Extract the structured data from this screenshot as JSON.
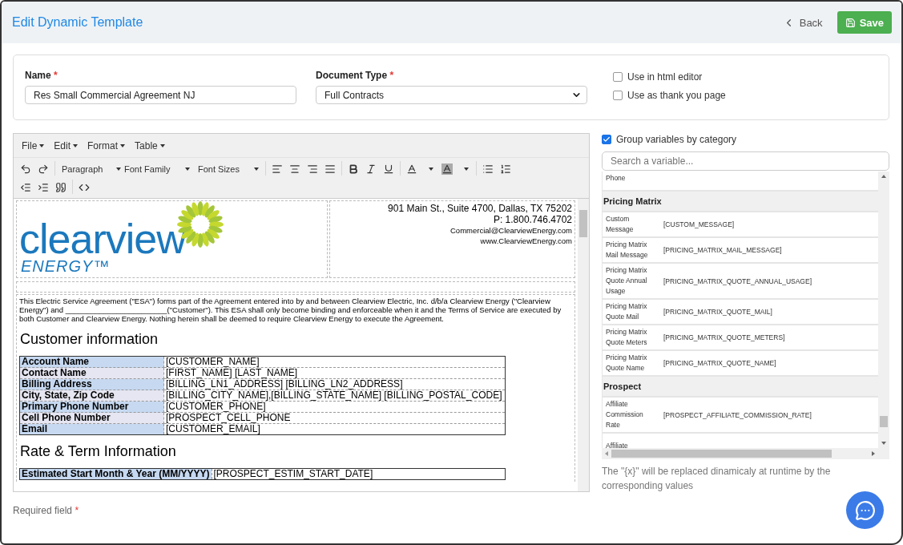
{
  "header": {
    "title": "Edit Dynamic Template",
    "back_label": "Back",
    "save_label": "Save"
  },
  "form": {
    "required_mark": "*",
    "name": {
      "label": "Name",
      "required": true,
      "value": "Res Small Commercial Agreement NJ"
    },
    "document_type": {
      "label": "Document Type",
      "required": true,
      "value": "Full Contracts"
    },
    "options": [
      {
        "label": "Use in html editor",
        "checked": false
      },
      {
        "label": "Use as thank you page",
        "checked": false
      }
    ]
  },
  "editor": {
    "menus": [
      "File",
      "Edit",
      "Format",
      "Table"
    ],
    "dropdowns": [
      "Paragraph",
      "Font Family",
      "Font Sizes"
    ],
    "document": {
      "logo": {
        "word": "clearview",
        "tagline": "ENERGY™"
      },
      "address": [
        {
          "text": "901 Main St., Suite 4700, Dallas, TX 75202",
          "kind": "large"
        },
        {
          "text": "P: 1.800.746.4702",
          "kind": "large"
        },
        {
          "text": "Commercial@ClearviewEnergy.com",
          "kind": "small"
        },
        {
          "text": "www.ClearviewEnergy.com",
          "kind": "small"
        }
      ],
      "intro": "This Electric Service Agreement (\"ESA\") forms part of the Agreement entered into by and between Clearview Electric, Inc. d/b/a Clearview Energy (\"Clearview Energy\") and ________________________(\"Customer\"). This ESA shall only become binding and enforceable when it and the Terms of Service are executed by both Customer and Clearview Energy. Nothing herein shall be deemed to require Clearview Energy to execute the Agreement.",
      "sections": [
        {
          "heading": "Customer information",
          "rows": [
            {
              "label": "Account Name",
              "value": "[CUSTOMER_NAME]"
            },
            {
              "label": "Contact Name",
              "value": "[FIRST_NAME] [LAST_NAME]"
            },
            {
              "label": "Billing Address",
              "value": "[BILLING_LN1_ADDRESS] [BILLING_LN2_ADDRESS]"
            },
            {
              "label": "City, State, Zip Code",
              "value": "[BILLING_CITY_NAME],[BILLING_STATE_NAME] [BILLING_POSTAL_CODE]"
            },
            {
              "label": "Primary Phone Number",
              "value": "[CUSTOMER_PHONE]"
            },
            {
              "label": "Cell Phone Number",
              "value": "[PROSPECT_CELL_PHONE"
            },
            {
              "label": "Email",
              "value": "[CUSTOMER_EMAIL]"
            }
          ]
        },
        {
          "heading": "Rate & Term Information",
          "rows": [
            {
              "label": "Estimated Start Month & Year (MM/YYYY)",
              "value": "[PROSPECT_ESTIM_START_DATE]"
            }
          ]
        }
      ]
    }
  },
  "variables": {
    "group_by_category": {
      "label": "Group variables by category",
      "checked": true
    },
    "search": {
      "placeholder": "Search a variable..."
    },
    "rows": [
      {
        "kind": "item",
        "label": "Phone"
      },
      {
        "kind": "category",
        "label": "Pricing Matrix"
      },
      {
        "kind": "item",
        "label": "Custom Message",
        "value": "[CUSTOM_MESSAGE]"
      },
      {
        "kind": "item",
        "label": "Pricing Matrix Mail Message",
        "value": "[PRICING_MATRIX_MAIL_MESSAGE]"
      },
      {
        "kind": "item",
        "label": "Pricing Matrix Quote Annual Usage",
        "value": "[PRICING_MATRIX_QUOTE_ANNUAL_USAGE]"
      },
      {
        "kind": "item",
        "label": "Pricing Matrix Quote Mail",
        "value": "[PRICING_MATRIX_QUOTE_MAIL]"
      },
      {
        "kind": "item",
        "label": "Pricing Matrix Quote Meters",
        "value": "[PRICING_MATRIX_QUOTE_METERS]"
      },
      {
        "kind": "item",
        "label": "Pricing Matrix Quote Name",
        "value": "[PRICING_MATRIX_QUOTE_NAME]"
      },
      {
        "kind": "category",
        "label": "Prospect"
      },
      {
        "kind": "item",
        "label": "Affiliate Commission Rate",
        "value": "[PROSPECT_AFFILIATE_COMMISSION_RATE]"
      },
      {
        "kind": "item",
        "label": "Affiliate"
      }
    ],
    "note": "The \"{x}\" will be replaced dinamicaly at runtime by the corresponding values"
  },
  "footer": {
    "required_note": "Required field"
  }
}
